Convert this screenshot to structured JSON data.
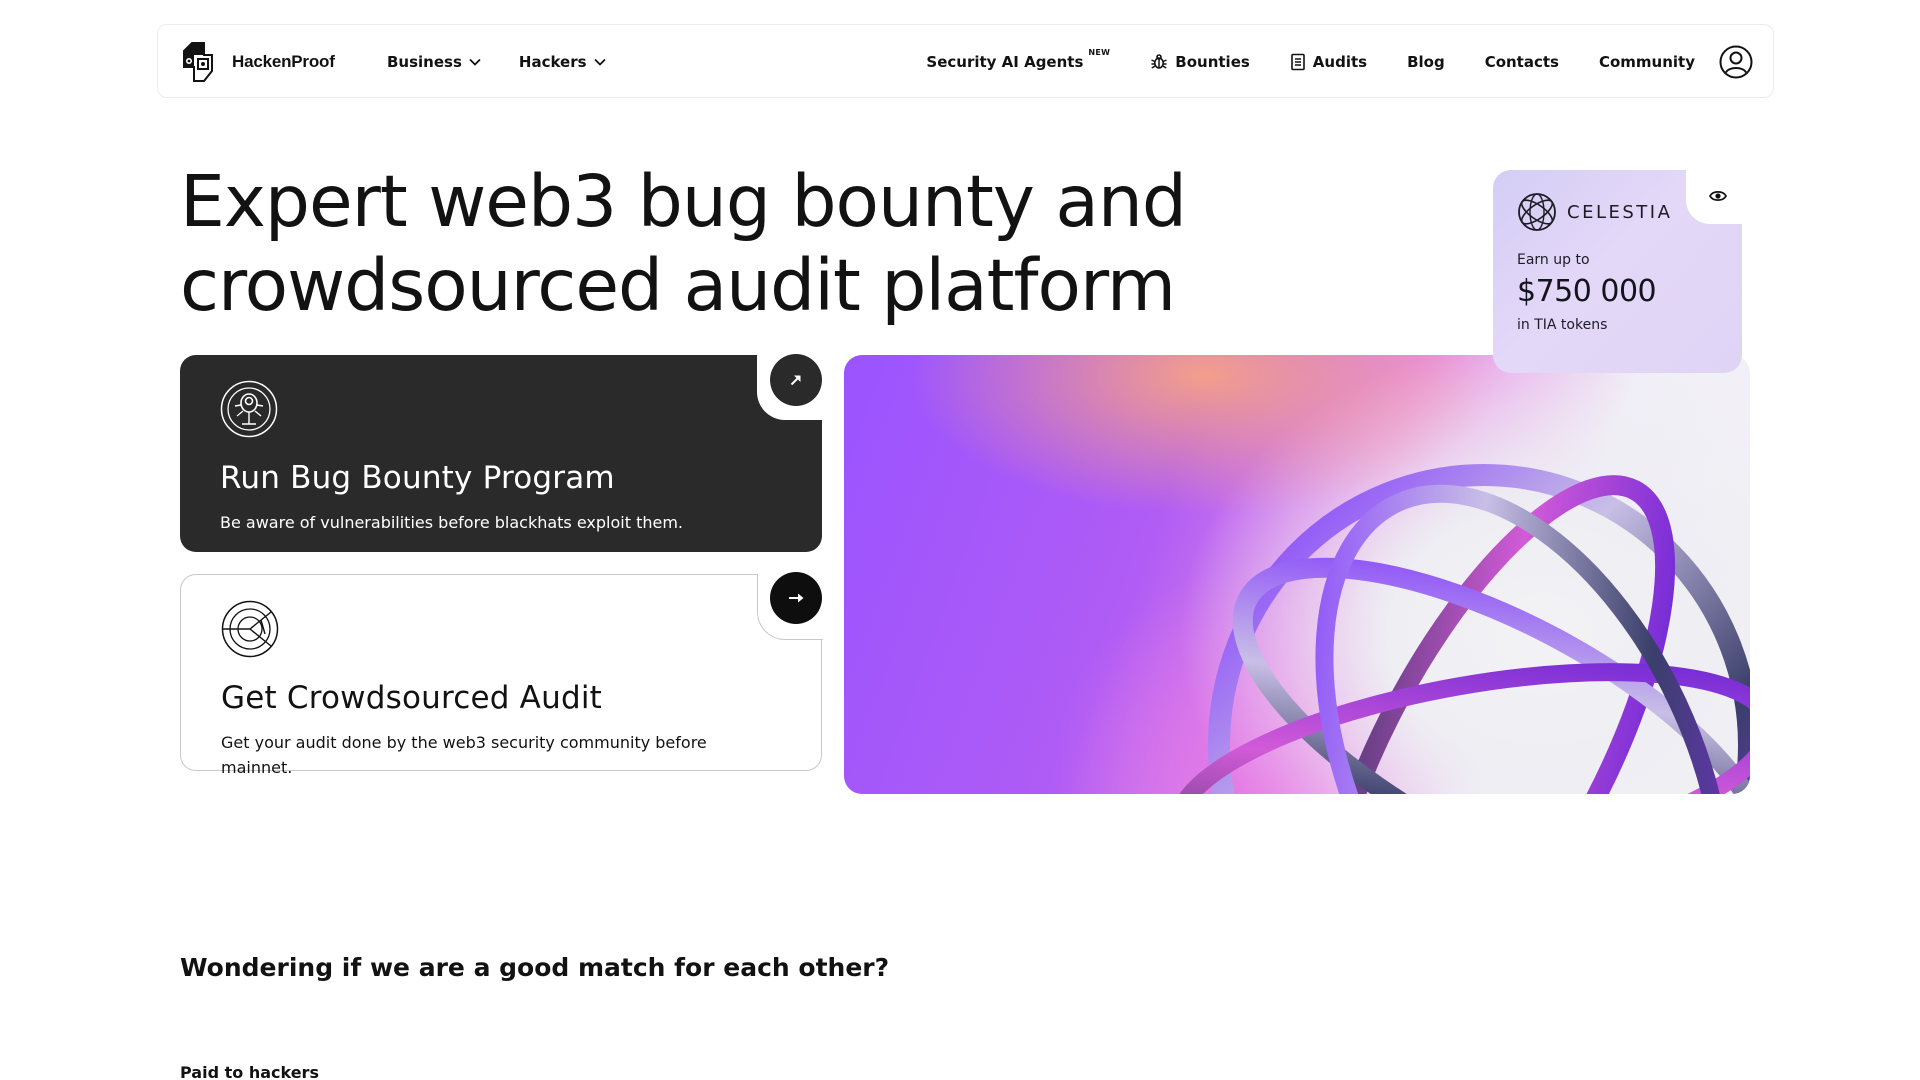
{
  "header": {
    "logo_text": "HackenProof",
    "nav_left": [
      {
        "label": "Business",
        "icon": "chevron-down-icon"
      },
      {
        "label": "Hackers",
        "icon": "chevron-down-icon"
      }
    ],
    "nav_right": {
      "ai_agents": "Security AI Agents",
      "ai_agents_badge": "NEW",
      "bounties": "Bounties",
      "audits": "Audits",
      "blog": "Blog",
      "contacts": "Contacts",
      "community": "Community"
    }
  },
  "hero": {
    "title_line1": "Expert web3 bug bounty and",
    "title_line2": "crowdsourced audit platform"
  },
  "cards": [
    {
      "title": "Run Bug Bounty Program",
      "description": "Be aware of vulnerabilities before blackhats exploit them.",
      "icon": "bug-target-icon",
      "arrow": "arrow-up-right-icon"
    },
    {
      "title": "Get Crowdsourced Audit",
      "description": "Get your audit done by the web3 security community before mainnet.",
      "icon": "radar-icon",
      "arrow": "arrow-right-icon"
    }
  ],
  "sponsor": {
    "name": "CELESTIA",
    "earn_label": "Earn up to",
    "amount": "$750 000",
    "token_label": "in TIA tokens"
  },
  "sections": {
    "match_question": "Wondering if we are a good match for each other?",
    "paid_label": "Paid to hackers"
  },
  "colors": {
    "dark_card": "#2a2a2a",
    "text": "#121212",
    "accent_purple": "#9a54ff"
  }
}
